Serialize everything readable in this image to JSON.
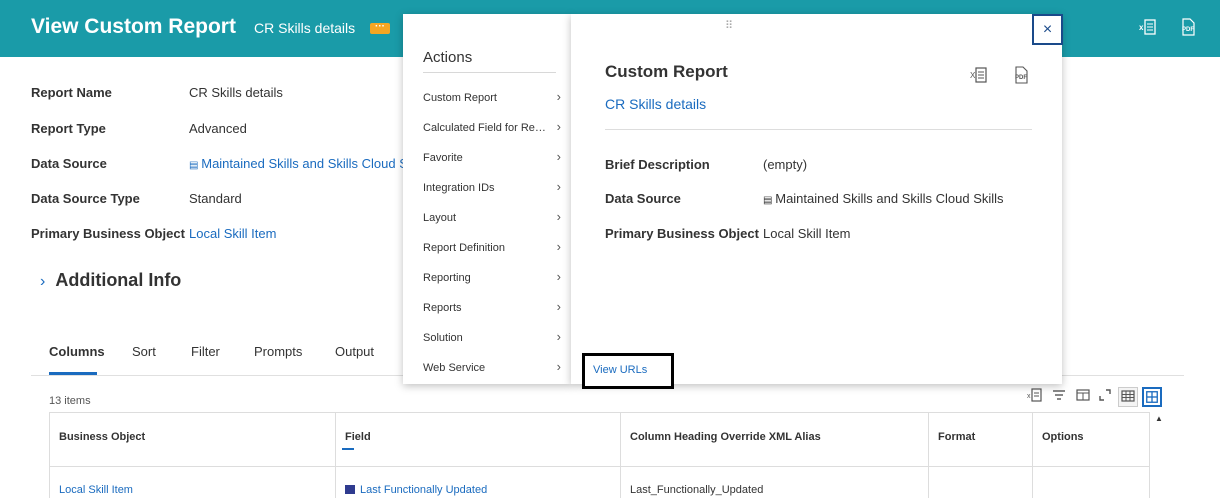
{
  "header": {
    "title": "View Custom Report",
    "subtitle": "CR Skills details",
    "more_icon": "ellipsis-icon",
    "excel_icon": "excel-export-icon",
    "pdf_icon": "pdf-export-icon",
    "pdf_label": "PDF",
    "bg_color": "#1a9ba8"
  },
  "details": [
    {
      "label": "Report Name",
      "value": "CR Skills details"
    },
    {
      "label": "Report Type",
      "value": "Advanced"
    },
    {
      "label": "Data Source",
      "value": "Maintained Skills and Skills Cloud S"
    },
    {
      "label": "Data Source Type",
      "value": "Standard"
    },
    {
      "label": "Primary Business Object",
      "value": "Local Skill Item"
    }
  ],
  "additional_info": "Additional Info",
  "tabs": [
    "Columns",
    "Sort",
    "Filter",
    "Prompts",
    "Output"
  ],
  "item_count": "13 items",
  "table": {
    "headers": [
      "Business Object",
      "Field",
      "Column Heading Override XML Alias",
      "Format",
      "Options"
    ],
    "rows": [
      [
        "Local Skill Item",
        "Last Functionally Updated",
        "Last_Functionally_Updated",
        "",
        ""
      ]
    ]
  },
  "actions": {
    "title": "Actions",
    "items": [
      "Custom Report",
      "Calculated Field for Re…",
      "Favorite",
      "Integration IDs",
      "Layout",
      "Report Definition",
      "Reporting",
      "Reports",
      "Solution",
      "Web Service"
    ]
  },
  "panel": {
    "title": "Custom Report",
    "link": "CR Skills details",
    "excel_label": "X",
    "pdf_label": "PDF",
    "rows": [
      {
        "label": "Brief Description",
        "value": "(empty)"
      },
      {
        "label": "Data Source",
        "value": "Maintained Skills and Skills Cloud Skills"
      },
      {
        "label": "Primary Business Object",
        "value": "Local Skill Item"
      }
    ]
  },
  "submenu": {
    "view_urls": "View URLs"
  },
  "close_label": "×"
}
